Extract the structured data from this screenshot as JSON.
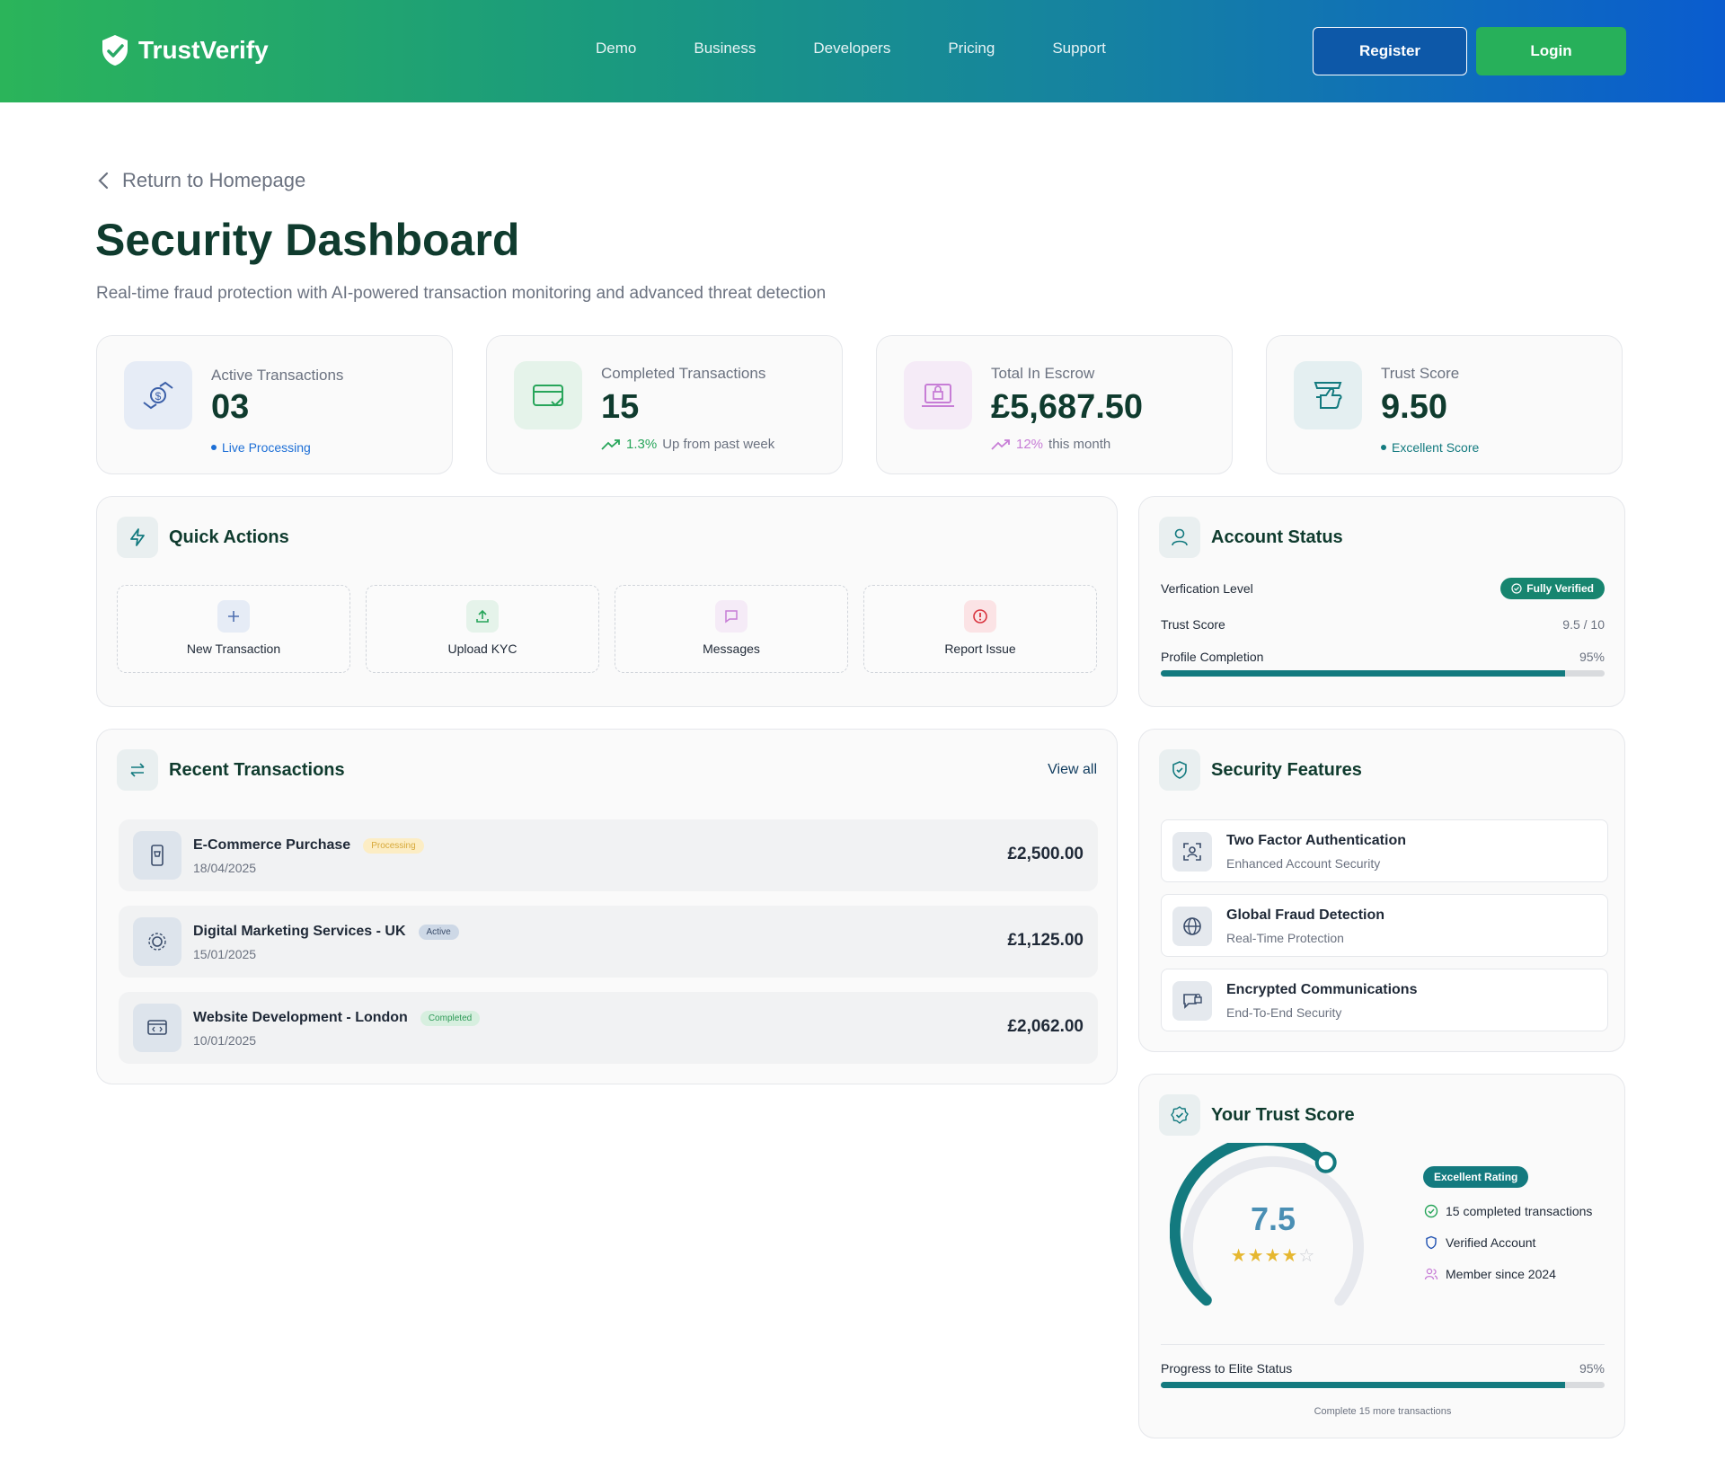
{
  "brand": {
    "name": "TrustVerify"
  },
  "nav": {
    "items": [
      "Demo",
      "Business",
      "Developers",
      "Pricing",
      "Support"
    ],
    "register": "Register",
    "login": "Login"
  },
  "page": {
    "back": "Return to Homepage",
    "title": "Security Dashboard",
    "subtitle": "Real-time fraud protection with AI-powered transaction monitoring and advanced threat detection"
  },
  "stats": [
    {
      "label": "Active Transactions",
      "value": "03",
      "foot": "Live Processing",
      "foot_color": "#1d6fd6",
      "icon": "exchange-money-icon"
    },
    {
      "label": "Completed Transactions",
      "value": "15",
      "trend": "1.3%",
      "foot": "Up from past week",
      "trend_color": "#27a55a",
      "icon": "card-check-icon"
    },
    {
      "label": "Total In Escrow",
      "value": "£5,687.50",
      "trend": "12%",
      "foot": "this month",
      "trend_color": "#c77dd6",
      "icon": "escrow-lock-icon"
    },
    {
      "label": "Trust Score",
      "value": "9.50",
      "foot": "Excellent Score",
      "foot_color": "#137a7f",
      "icon": "handshake-icon"
    }
  ],
  "quick_actions": {
    "title": "Quick Actions",
    "items": [
      {
        "label": "New Transaction",
        "icon": "plus-icon",
        "color": "#4f6fb0"
      },
      {
        "label": "Upload KYC",
        "icon": "upload-icon",
        "color": "#27a55a"
      },
      {
        "label": "Messages",
        "icon": "message-icon",
        "color": "#c77dd6"
      },
      {
        "label": "Report Issue",
        "icon": "alert-icon",
        "color": "#d9343f"
      }
    ]
  },
  "recent": {
    "title": "Recent Transactions",
    "view_all": "View all",
    "items": [
      {
        "name": "E-Commerce Purchase",
        "status": "Processing",
        "date": "18/04/2025",
        "amount": "£2,500.00",
        "icon": "phone-cart-icon"
      },
      {
        "name": "Digital Marketing Services - UK",
        "status": "Active",
        "date": "15/01/2025",
        "amount": "£1,125.00",
        "icon": "marketing-gear-icon"
      },
      {
        "name": "Website Development - London",
        "status": "Completed",
        "date": "10/01/2025",
        "amount": "£2,062.00",
        "icon": "code-window-icon"
      }
    ]
  },
  "account": {
    "title": "Account Status",
    "verification_label": "Verfication Level",
    "verification_badge": "Fully Verified",
    "trust_label": "Trust Score",
    "trust_value": "9.5 / 10",
    "profile_label": "Profile Completion",
    "profile_value": "95%",
    "profile_progress": 0.91
  },
  "security": {
    "title": "Security Features",
    "items": [
      {
        "title": "Two Factor Authentication",
        "sub": "Enhanced Account Security",
        "icon": "face-scan-icon"
      },
      {
        "title": "Global Fraud Detection",
        "sub": "Real-Time Protection",
        "icon": "globe-icon"
      },
      {
        "title": "Encrypted Communications",
        "sub": "End-To-End Security",
        "icon": "chat-lock-icon"
      }
    ]
  },
  "trust": {
    "title": "Your Trust Score",
    "score": "7.5",
    "stars_filled": 4,
    "stars_total": 5,
    "rating_badge": "Excellent Rating",
    "items": [
      {
        "text": "15 completed transactions",
        "icon": "check-circle-icon",
        "color": "#27a55a"
      },
      {
        "text": "Verified Account",
        "icon": "shield-icon",
        "color": "#1d4fb0"
      },
      {
        "text": "Member since 2024",
        "icon": "users-icon",
        "color": "#c77dd6"
      }
    ],
    "elite_label": "Progress to Elite Status",
    "elite_value": "95%",
    "elite_progress": 0.91,
    "elite_note": "Complete 15 more transactions"
  }
}
